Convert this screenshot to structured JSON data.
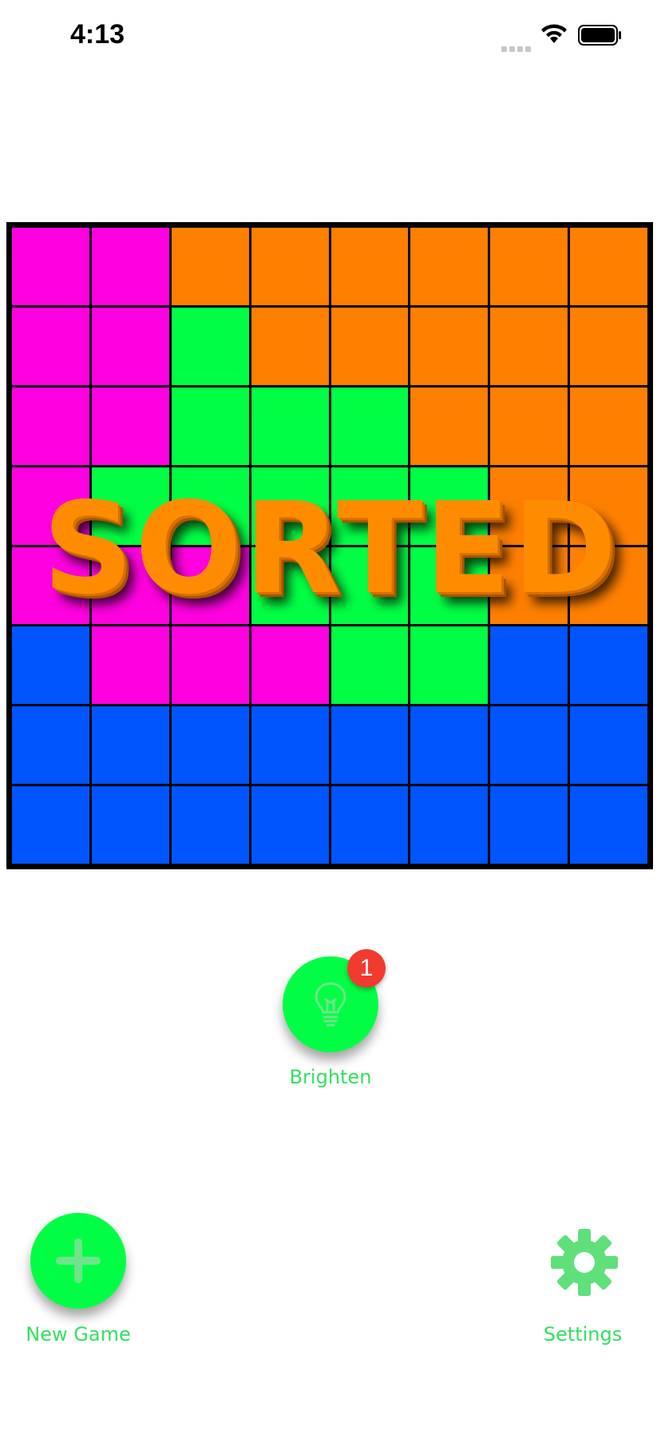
{
  "status_bar": {
    "time": "4:13"
  },
  "board": {
    "colors": {
      "M": "#ff00e1",
      "O": "#ff7f00",
      "G": "#00ff44",
      "B": "#0055ff"
    },
    "rows": [
      [
        "M",
        "M",
        "O",
        "O",
        "O",
        "O",
        "O",
        "O"
      ],
      [
        "M",
        "M",
        "G",
        "O",
        "O",
        "O",
        "O",
        "O"
      ],
      [
        "M",
        "M",
        "G",
        "G",
        "G",
        "O",
        "O",
        "O"
      ],
      [
        "M",
        "G",
        "G",
        "G",
        "G",
        "G",
        "O",
        "O"
      ],
      [
        "M",
        "M",
        "M",
        "G",
        "G",
        "G",
        "O",
        "O"
      ],
      [
        "B",
        "M",
        "M",
        "M",
        "G",
        "G",
        "B",
        "B"
      ],
      [
        "B",
        "B",
        "B",
        "B",
        "B",
        "B",
        "B",
        "B"
      ],
      [
        "B",
        "B",
        "B",
        "B",
        "B",
        "B",
        "B",
        "B"
      ]
    ]
  },
  "overlay": {
    "text": "SORTED"
  },
  "brighten": {
    "label": "Brighten",
    "badge": "1",
    "icon": "lightbulb-icon"
  },
  "new_game": {
    "label": "New Game",
    "icon": "plus-icon"
  },
  "settings": {
    "label": "Settings",
    "icon": "gear-icon"
  },
  "accent_color": "#00ff44"
}
